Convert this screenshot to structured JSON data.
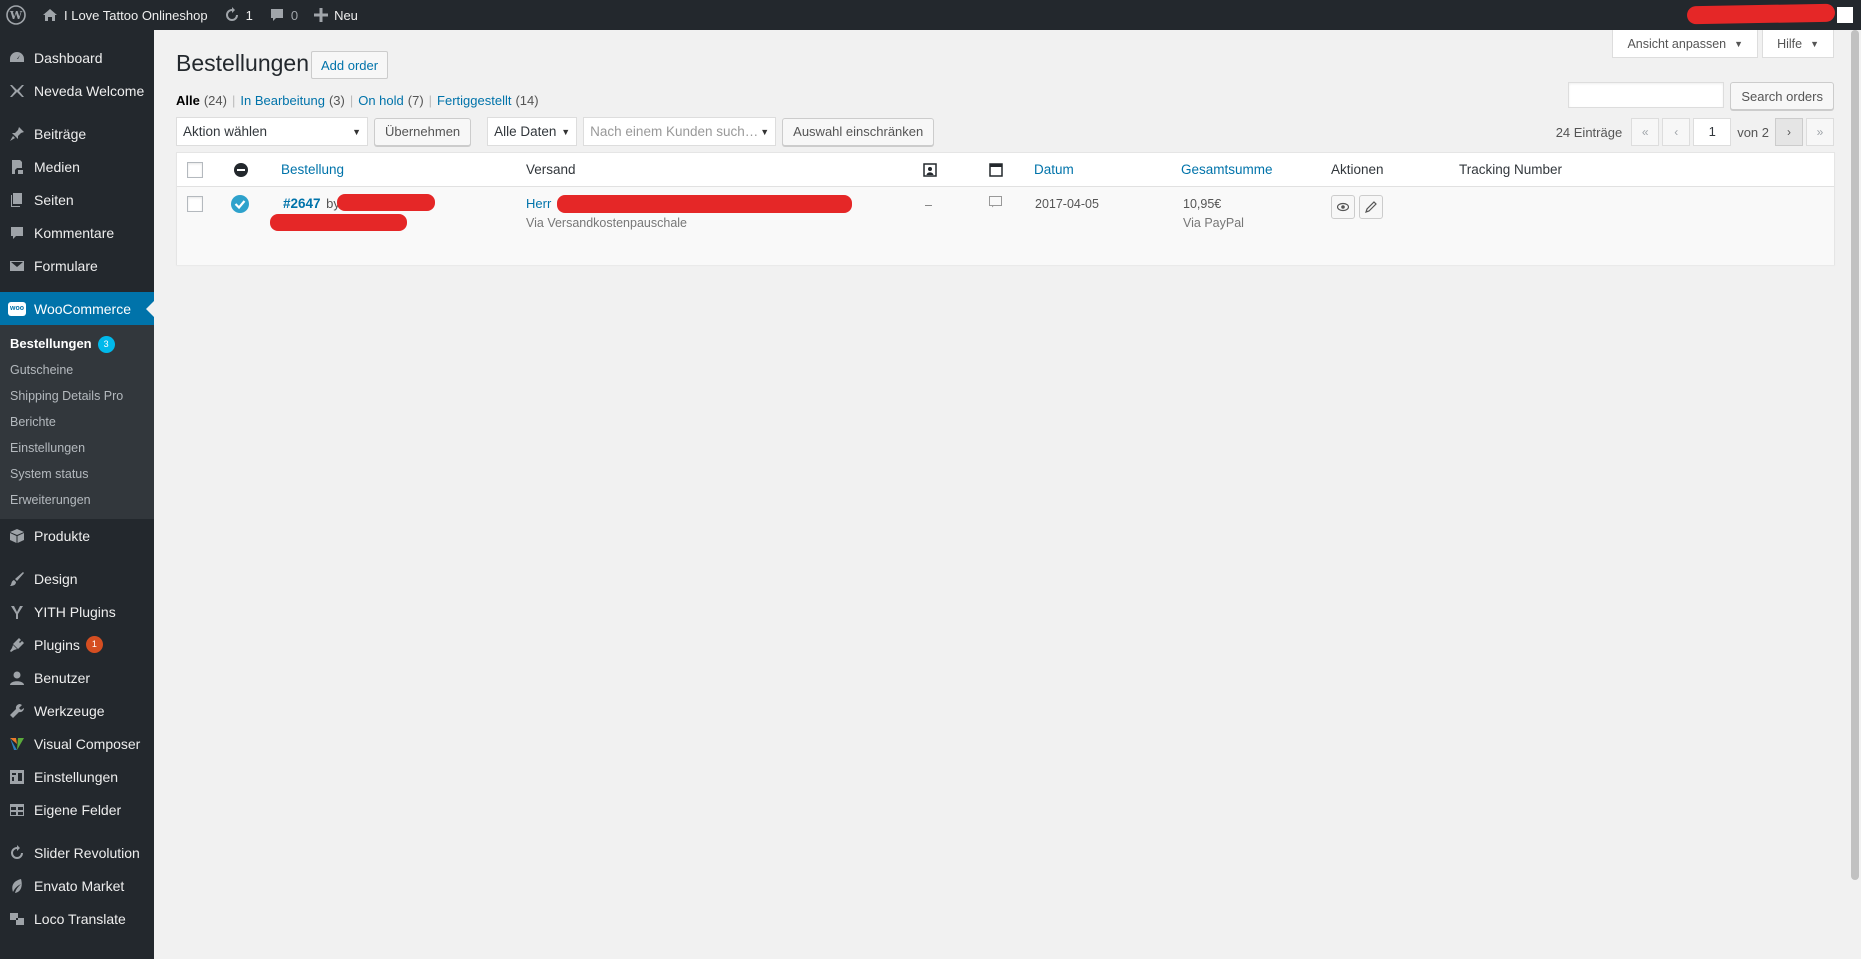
{
  "admin_bar": {
    "site_name": "I Love Tattoo Onlineshop",
    "updates_count": "1",
    "comments_count": "0",
    "new_label": "Neu"
  },
  "sidebar": {
    "items": [
      {
        "label": "Dashboard",
        "icon": "dashboard-icon"
      },
      {
        "label": "Neveda Welcome",
        "icon": "neveda-icon"
      },
      {
        "label": "Beiträge",
        "icon": "pin-icon"
      },
      {
        "label": "Medien",
        "icon": "media-icon"
      },
      {
        "label": "Seiten",
        "icon": "pages-icon"
      },
      {
        "label": "Kommentare",
        "icon": "comments-icon"
      },
      {
        "label": "Formulare",
        "icon": "mail-icon"
      },
      {
        "label": "WooCommerce",
        "icon": "woo-icon"
      },
      {
        "label": "Produkte",
        "icon": "box-icon"
      },
      {
        "label": "Design",
        "icon": "brush-icon"
      },
      {
        "label": "YITH Plugins",
        "icon": "yith-icon"
      },
      {
        "label": "Plugins",
        "icon": "plugin-icon",
        "badge": "1"
      },
      {
        "label": "Benutzer",
        "icon": "user-icon"
      },
      {
        "label": "Werkzeuge",
        "icon": "wrench-icon"
      },
      {
        "label": "Visual Composer",
        "icon": "vc-icon"
      },
      {
        "label": "Einstellungen",
        "icon": "settings-icon"
      },
      {
        "label": "Eigene Felder",
        "icon": "table-icon"
      },
      {
        "label": "Slider Revolution",
        "icon": "refresh-icon"
      },
      {
        "label": "Envato Market",
        "icon": "leaf-icon"
      },
      {
        "label": "Loco Translate",
        "icon": "translate-icon"
      }
    ],
    "woo_submenu": [
      {
        "label": "Bestellungen",
        "badge": "3"
      },
      {
        "label": "Gutscheine"
      },
      {
        "label": "Shipping Details Pro"
      },
      {
        "label": "Berichte"
      },
      {
        "label": "Einstellungen"
      },
      {
        "label": "System status"
      },
      {
        "label": "Erweiterungen"
      }
    ]
  },
  "screen_options": {
    "label": "Ansicht anpassen",
    "help": "Hilfe"
  },
  "page": {
    "title": "Bestellungen",
    "add_order": "Add order"
  },
  "views": [
    {
      "label": "Alle",
      "count": "(24)"
    },
    {
      "label": "In Bearbeitung",
      "count": "(3)"
    },
    {
      "label": "On hold",
      "count": "(7)"
    },
    {
      "label": "Fertiggestellt",
      "count": "(14)"
    }
  ],
  "search": {
    "button": "Search orders"
  },
  "tablenav": {
    "bulk_action": "Aktion wählen",
    "apply": "Übernehmen",
    "date_filter": "Alle Daten",
    "customer_placeholder": "Nach einem Kunden such…",
    "filter_button": "Auswahl einschränken"
  },
  "pagination": {
    "items": "24 Einträge",
    "first": "«",
    "prev": "‹",
    "current": "1",
    "of": "von 2",
    "next": "›",
    "last": "»"
  },
  "table": {
    "headers": {
      "order": "Bestellung",
      "shipping": "Versand",
      "date": "Datum",
      "total": "Gesamtsumme",
      "actions": "Aktionen",
      "tracking": "Tracking Number"
    },
    "rows": [
      {
        "order_no": "#2647",
        "by": "by",
        "ship_prefix": "Herr",
        "ship_method": "Via Versandkostenpauschale",
        "notes": "–",
        "date": "2017-04-05",
        "total": "10,95€",
        "payment": "Via PayPal"
      }
    ]
  }
}
